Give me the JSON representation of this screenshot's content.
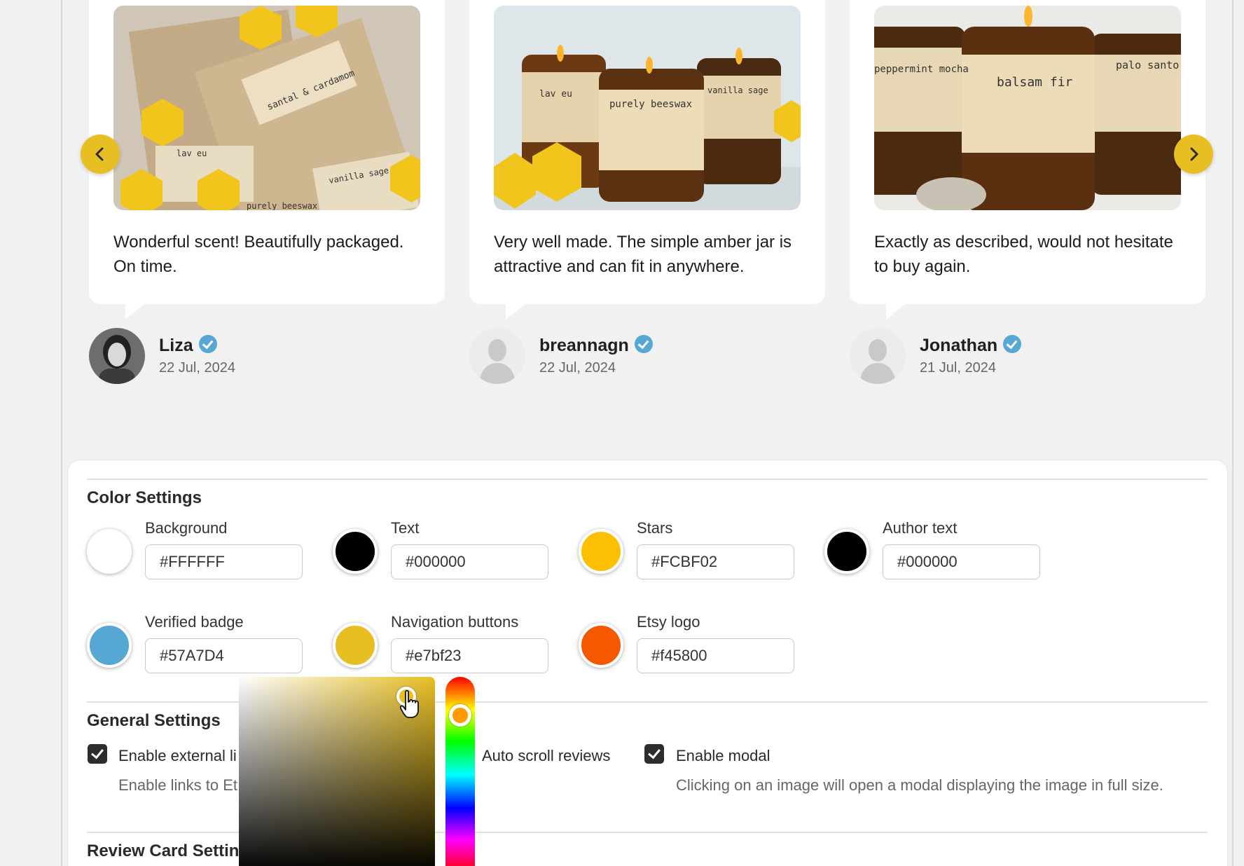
{
  "reviews": [
    {
      "quote": "Wonderful scent! Beautifully packaged. On time.",
      "author": "Liza",
      "date": "22 Jul, 2024",
      "photo_labels": [
        "santal & cardamom",
        "lav eu",
        "vanilla sage",
        "purely beeswax"
      ]
    },
    {
      "quote": "Very well made. The simple amber jar is attractive and can fit in anywhere.",
      "author": "breannagn",
      "date": "22 Jul, 2024",
      "photo_labels": [
        "lav eu",
        "purely beeswax",
        "vanilla sage"
      ]
    },
    {
      "quote": "Exactly as described, would not hesitate to buy again.",
      "author": "Jonathan",
      "date": "21 Jul, 2024",
      "photo_labels": [
        "peppermint mocha",
        "balsam fir",
        "palo santo"
      ]
    }
  ],
  "carousel": {
    "prev_icon": "chevron-left-icon",
    "next_icon": "chevron-right-icon"
  },
  "color_settings": {
    "title": "Color Settings",
    "fields": [
      {
        "label": "Background",
        "value": "#FFFFFF",
        "color": "#FFFFFF"
      },
      {
        "label": "Text",
        "value": "#000000",
        "color": "#000000"
      },
      {
        "label": "Stars",
        "value": "#FCBF02",
        "color": "#FCBF02"
      },
      {
        "label": "Author text",
        "value": "#000000",
        "color": "#000000"
      },
      {
        "label": "Verified badge",
        "value": "#57A7D4",
        "color": "#57A7D4"
      },
      {
        "label": "Navigation buttons",
        "value": "#e7bf23",
        "color": "#e7bf23"
      },
      {
        "label": "Etsy logo",
        "value": "#f45800",
        "color": "#f45800"
      }
    ]
  },
  "general_settings": {
    "title": "General Settings",
    "external_links": {
      "label": "Enable external li",
      "help": "Enable links to Et",
      "checked": true
    },
    "auto_scroll": {
      "label": "Auto scroll reviews"
    },
    "modal": {
      "label": "Enable modal",
      "help": "Clicking on an image will open a modal displaying the image in full size.",
      "checked": true
    }
  },
  "review_card_settings": {
    "title": "Review Card Settin"
  },
  "color_picker": {
    "color": "#e7bf23"
  }
}
